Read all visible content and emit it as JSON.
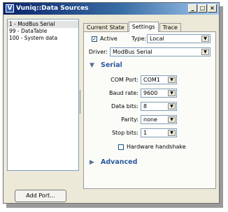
{
  "window": {
    "title": "Vuniq::Data Sources",
    "icon": "V",
    "controls": {
      "minimize": "_",
      "maximize": "□",
      "close": "×"
    }
  },
  "ports": [
    "1 - ModBus Serial",
    "99 - DataTable",
    "100 - System data"
  ],
  "add_port_label": "Add Port...",
  "tabs": [
    "Current State",
    "Settings",
    "Trace"
  ],
  "settings": {
    "active_label": "Active",
    "active_checked": true,
    "check_mark": "✓",
    "type_label": "Type:",
    "type_value": "Local",
    "driver_label": "Driver:",
    "driver_value": "ModBus Serial",
    "serial_section": {
      "title": "Serial",
      "fields": {
        "com_port": {
          "label": "COM Port:",
          "value": "COM1"
        },
        "baud_rate": {
          "label": "Baud rate:",
          "value": "9600"
        },
        "data_bits": {
          "label": "Data bits:",
          "value": "8"
        },
        "parity": {
          "label": "Parity:",
          "value": "none"
        },
        "stop_bits": {
          "label": "Stop bits:",
          "value": "1"
        }
      },
      "handshake_label": "Hardware handshake",
      "handshake_checked": false
    },
    "advanced_label": "Advanced",
    "expanded_glyph": "▼",
    "collapsed_glyph": "▶",
    "dropdown_glyph": "▼"
  }
}
